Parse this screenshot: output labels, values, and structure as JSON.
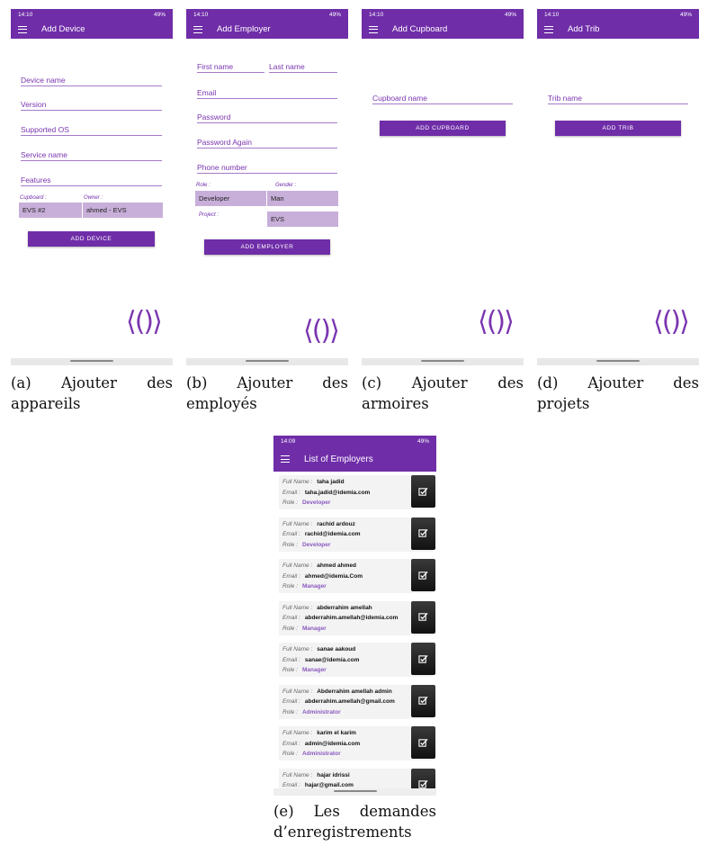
{
  "screens": {
    "a": {
      "status": {
        "time": "14:10",
        "right": "49%"
      },
      "title": "Add Device",
      "fields": [
        "Device name",
        "Version",
        "Supported OS",
        "Service name",
        "Features"
      ],
      "labels": {
        "cupboard": "Cupboard :",
        "owner": "Owner :"
      },
      "selects": {
        "cupboard": "EVS #2",
        "owner": "ahmed - EVS"
      },
      "button": "ADD DEVICE"
    },
    "b": {
      "status": {
        "time": "14:10",
        "right": "49%"
      },
      "title": "Add Employer",
      "fields": {
        "first_name": "First name",
        "last_name": "Last name",
        "email": "Email",
        "password": "Password",
        "password_again": "Password Again",
        "phone": "Phone number"
      },
      "labels": {
        "role": "Role :",
        "gender": "Gender :",
        "project": "Project :"
      },
      "selects": {
        "role": "Developer",
        "gender": "Man",
        "project": "EVS"
      },
      "button": "ADD EMPLOYER"
    },
    "c": {
      "status": {
        "time": "14:10",
        "right": "49%"
      },
      "title": "Add Cupboard",
      "field": "Cupboard name",
      "button": "ADD CUPBOARD"
    },
    "d": {
      "status": {
        "time": "14:10",
        "right": "49%"
      },
      "title": "Add Trib",
      "field": "Trib name",
      "button": "ADD TRIB"
    },
    "e": {
      "status": {
        "time": "14:09",
        "right": "49%"
      },
      "title": "List of Employers",
      "labels": {
        "full_name": "Full Name :",
        "email": "Email :",
        "role": "Role :"
      },
      "employers": [
        {
          "name": "taha jadid",
          "email": "taha.jadid@idemia.com",
          "role": "Developer"
        },
        {
          "name": "rachid ardouz",
          "email": "rachid@idemia.com",
          "role": "Developer"
        },
        {
          "name": "ahmed ahmed",
          "email": "ahmed@idemia.Com",
          "role": "Manager"
        },
        {
          "name": "abderrahim amellah",
          "email": "abderrahim.amellah@idemia.com",
          "role": "Manager"
        },
        {
          "name": "sanae aakoud",
          "email": "sanae@idemia.com",
          "role": "Manager"
        },
        {
          "name": "Abderrahim amellah admin",
          "email": "abderrahim.amellah@gmail.com",
          "role": "Administrator"
        },
        {
          "name": "karim el karim",
          "email": "admin@idemia.com",
          "role": "Administrator"
        },
        {
          "name": "hajar idrissi",
          "email": "hajar@gmail.com",
          "role": ""
        }
      ]
    }
  },
  "brand_glyph": "⟨()⟩",
  "captions": {
    "a": {
      "line1_left": "(a)",
      "line1_mid": "Ajouter",
      "line1_right": "des",
      "line2": "appareils"
    },
    "b": {
      "line1_left": "(b)",
      "line1_mid": "Ajouter",
      "line1_right": "des",
      "line2": "employés"
    },
    "c": {
      "line1_left": "(c)",
      "line1_mid": "Ajouter",
      "line1_right": "des",
      "line2": "armoires"
    },
    "d": {
      "line1_left": "(d)",
      "line1_mid": "Ajouter",
      "line1_right": "des",
      "line2": "projets"
    },
    "e": {
      "line1_left": "(e)",
      "line1_mid": "Les",
      "line1_right": "demandes",
      "line2": "d’enregistrements"
    }
  },
  "colors": {
    "primary": "#6f2da8",
    "select_bg": "#c8afd9",
    "field_text": "#7a35b0"
  }
}
